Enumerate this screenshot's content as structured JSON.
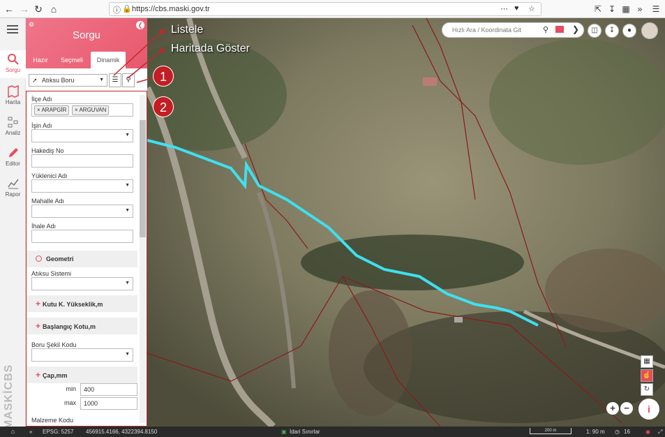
{
  "browser": {
    "url": "https://cbs.maski.gov.tr"
  },
  "rail": {
    "items": [
      {
        "label": "Sorgu",
        "icon": "search-icon"
      },
      {
        "label": "Harita",
        "icon": "map-icon"
      },
      {
        "label": "Analiz",
        "icon": "analysis-icon"
      },
      {
        "label": "Editor",
        "icon": "pencil-icon"
      },
      {
        "label": "Rapor",
        "icon": "report-icon"
      }
    ],
    "logo": "MASKİCBS"
  },
  "panel": {
    "title": "Sorgu",
    "tabs": [
      "Hazır",
      "Seçmeli",
      "Dinamik"
    ],
    "active_tab": "Dinamik",
    "layer": "Atıksu Boru",
    "fields": {
      "ilce": {
        "label": "İlçe Adı",
        "tags": [
          "ARAPGİR",
          "ARGUVAN"
        ]
      },
      "isin": {
        "label": "İşin Adı"
      },
      "hakedis": {
        "label": "Hakediş No"
      },
      "yuklenici": {
        "label": "Yüklenici Adı"
      },
      "mahalle": {
        "label": "Mahalle Adı"
      },
      "ihale": {
        "label": "İhale Adı"
      },
      "geometri": {
        "label": "Geometri"
      },
      "atiksu": {
        "label": "Atıksu Sistemi"
      },
      "kutu": {
        "label": "Kutu K. Yükseklik,m"
      },
      "baslangic": {
        "label": "Başlangıç Kotu,m"
      },
      "boru_sekil": {
        "label": "Boru Şekil Kodu"
      },
      "cap": {
        "label": "Çap,mm",
        "min_label": "min",
        "min": "400",
        "max_label": "max",
        "max": "1000"
      },
      "malzeme": {
        "label": "Malzeme Kodu"
      }
    }
  },
  "annotations": {
    "listele": "Listele",
    "haritada": "Haritada Göster",
    "n1": "1",
    "n2": "2"
  },
  "map": {
    "search_placeholder": "Hızlı Ara / Koordinata Git"
  },
  "status": {
    "epsg": "EPSG: 5257",
    "coords": "456915.4166, 4322394.8150",
    "layer": "İdari Sınırlar",
    "scale_label": "200 m",
    "ratio": "1: 90 m",
    "zoom": "16"
  }
}
